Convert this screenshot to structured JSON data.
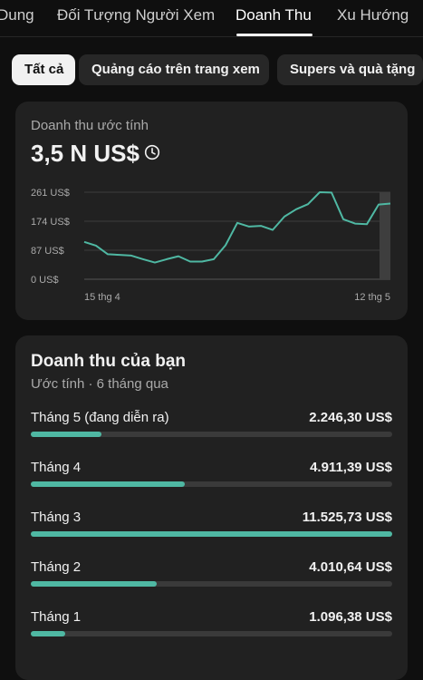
{
  "tabs": [
    {
      "label": "Dung",
      "active": false
    },
    {
      "label": "Đối Tượng Người Xem",
      "active": false
    },
    {
      "label": "Doanh Thu",
      "active": true
    },
    {
      "label": "Xu Hướng",
      "active": false
    }
  ],
  "chips": [
    {
      "label": "Tất cả",
      "active": true
    },
    {
      "label": "Quảng cáo trên trang xem",
      "active": false
    },
    {
      "label": "Supers và quà tặng",
      "active": false
    }
  ],
  "estimate": {
    "label": "Doanh thu ước tính",
    "value": "3,5 N US$",
    "icon": "clock-icon"
  },
  "chart_data": {
    "type": "line",
    "yticks": [
      "261 US$",
      "174 US$",
      "87 US$",
      "0 US$"
    ],
    "ylim": [
      0,
      261
    ],
    "xlabels": [
      "15 thg 4",
      "12 thg 5"
    ],
    "color": "#4fb8a3",
    "values": [
      112,
      101,
      75,
      73,
      71,
      60,
      50,
      60,
      69,
      53,
      53,
      60,
      102,
      169,
      158,
      160,
      148,
      188,
      210,
      225,
      261,
      260,
      180,
      167,
      165,
      224,
      227
    ]
  },
  "revenue": {
    "title": "Doanh thu của bạn",
    "subtitle": "Ước tính · 6 tháng qua",
    "accent": "#4fb8a3",
    "rows": [
      {
        "label": "Tháng 5 (đang diễn ra)",
        "value": "2.246,30 US$",
        "fraction": 0.195
      },
      {
        "label": "Tháng 4",
        "value": "4.911,39 US$",
        "fraction": 0.426
      },
      {
        "label": "Tháng 3",
        "value": "11.525,73 US$",
        "fraction": 1.0
      },
      {
        "label": "Tháng 2",
        "value": "4.010,64 US$",
        "fraction": 0.348
      },
      {
        "label": "Tháng 1",
        "value": "1.096,38 US$",
        "fraction": 0.095
      }
    ]
  }
}
